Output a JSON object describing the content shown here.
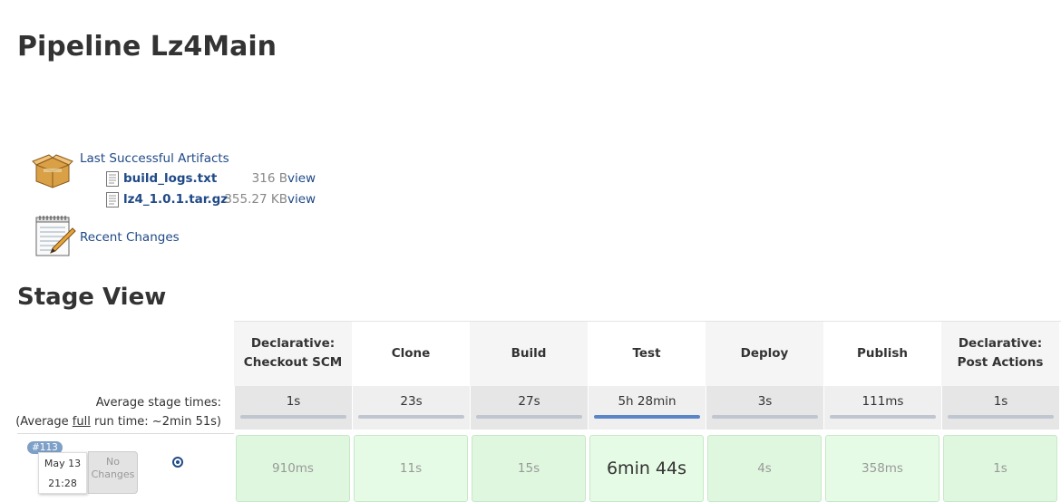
{
  "page": {
    "title": "Pipeline Lz4Main"
  },
  "artifacts": {
    "label": "Last Successful Artifacts",
    "files": [
      {
        "name": "build_logs.txt",
        "size": "316 B",
        "action": "view"
      },
      {
        "name": "lz4_1.0.1.tar.gz",
        "size": "355.27 KB",
        "action": "view"
      }
    ]
  },
  "recent_changes": {
    "label": "Recent Changes"
  },
  "stage_view": {
    "title": "Stage View",
    "stages": [
      {
        "name": "Declarative: Checkout SCM",
        "avg": "1s",
        "run": "910ms"
      },
      {
        "name": "Clone",
        "avg": "23s",
        "run": "11s"
      },
      {
        "name": "Build",
        "avg": "27s",
        "run": "15s"
      },
      {
        "name": "Test",
        "avg": "5h 28min",
        "run": "6min 44s"
      },
      {
        "name": "Deploy",
        "avg": "3s",
        "run": "4s"
      },
      {
        "name": "Publish",
        "avg": "111ms",
        "run": "358ms"
      },
      {
        "name": "Declarative: Post Actions",
        "avg": "1s",
        "run": "1s"
      }
    ],
    "avg_label_line1": "Average stage times:",
    "avg_label_line2_prefix": "(Average ",
    "avg_label_line2_link": "full",
    "avg_label_line2_suffix": " run time: ~2min 51s)",
    "run": {
      "build_number": "#113",
      "date": "May 13",
      "time": "21:28",
      "no_changes": "No Changes"
    }
  }
}
